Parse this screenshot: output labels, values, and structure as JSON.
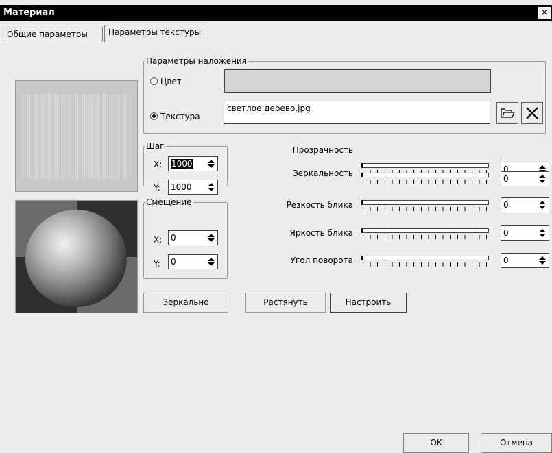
{
  "window": {
    "title": "Материал",
    "close_symbol": "×"
  },
  "tabs": [
    {
      "label": "Общие параметры",
      "active": false
    },
    {
      "label": "Параметры текстуры",
      "active": true
    }
  ],
  "overlay": {
    "legend": "Параметры наложения",
    "color_label": "Цвет",
    "texture_label": "Текстура",
    "selected": "Текстура",
    "texture_file": "светлое дерево.jpg",
    "icons": [
      "folder-open-icon",
      "clear-x-icon"
    ]
  },
  "step": {
    "legend": "Шаг",
    "x_label": "X:",
    "x_value": "1000",
    "y_label": "Y:",
    "y_value": "1000"
  },
  "offset": {
    "legend": "Смещение",
    "x_label": "X:",
    "x_value": "0",
    "y_label": "Y:",
    "y_value": "0"
  },
  "sliders": [
    {
      "label": "Прозрачность",
      "value": "0"
    },
    {
      "label": "Зеркальность",
      "value": "0"
    },
    {
      "label": "Резкость блика",
      "value": "0"
    },
    {
      "label": "Яркость блика",
      "value": "0"
    },
    {
      "label": "Угол поворота",
      "value": "0"
    }
  ],
  "actions": {
    "mirror": "Зеркально",
    "stretch": "Растянуть",
    "adjust": "Настроить"
  },
  "footer": {
    "ok": "OK",
    "cancel": "Отмена"
  }
}
